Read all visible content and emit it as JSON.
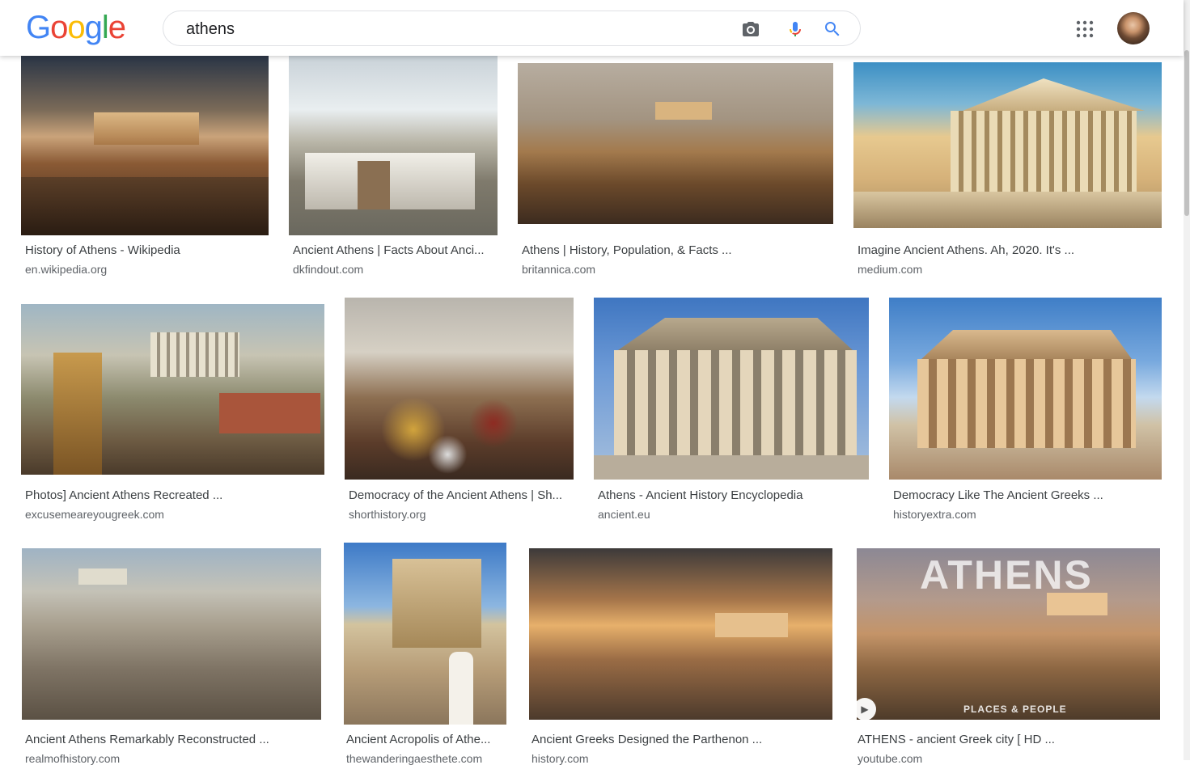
{
  "header": {
    "logo_letters": [
      "G",
      "o",
      "o",
      "g",
      "l",
      "e"
    ],
    "logo_colors": [
      "#4285F4",
      "#EA4335",
      "#FBBC05",
      "#4285F4",
      "#34A853",
      "#EA4335"
    ],
    "search_value": "athens",
    "icons": {
      "camera": "camera-icon",
      "mic": "microphone-icon",
      "search": "search-icon",
      "apps": "apps-grid-icon",
      "avatar": "account-avatar"
    }
  },
  "results": [
    {
      "title": "History of Athens - Wikipedia",
      "source": "en.wikipedia.org"
    },
    {
      "title": "Ancient Athens | Facts About Anci...",
      "source": "dkfindout.com"
    },
    {
      "title": "Athens | History, Population, & Facts ...",
      "source": "britannica.com"
    },
    {
      "title": "Imagine Ancient Athens. Ah, 2020. It's ...",
      "source": "medium.com"
    },
    {
      "title": "Photos] Ancient Athens Recreated ...",
      "source": "excusemeareyougreek.com"
    },
    {
      "title": "Democracy of the Ancient Athens | Sh...",
      "source": "shorthistory.org"
    },
    {
      "title": "Athens - Ancient History Encyclopedia",
      "source": "ancient.eu"
    },
    {
      "title": "Democracy Like The Ancient Greeks ...",
      "source": "historyextra.com"
    },
    {
      "title": "Ancient Athens Remarkably Reconstructed ...",
      "source": "realmofhistory.com"
    },
    {
      "title": "Ancient Acropolis of Athe...",
      "source": "thewanderingaesthete.com"
    },
    {
      "title": "Ancient Greeks Designed the Parthenon ...",
      "source": "history.com"
    },
    {
      "title": "ATHENS - ancient Greek city [ HD ...",
      "source": "youtube.com",
      "overlay_title": "ATHENS",
      "overlay_caption": "PLACES & PEOPLE"
    }
  ]
}
